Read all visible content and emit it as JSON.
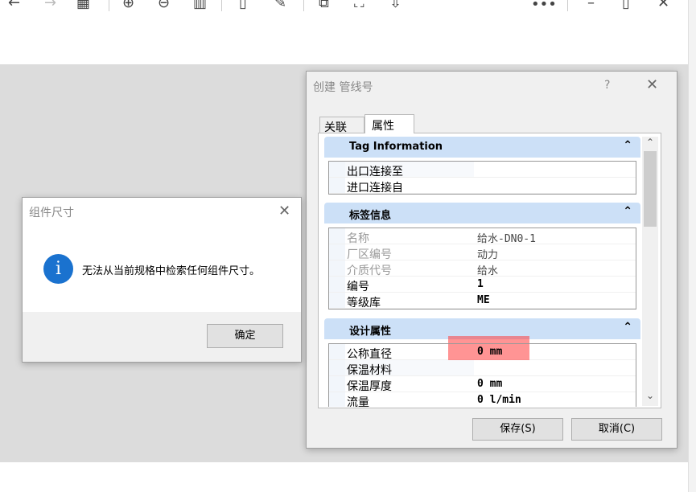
{
  "toolbar": {
    "icons": [
      "back-icon",
      "forward-icon",
      "grid-icon",
      "zoom-in-icon",
      "zoom-out-icon",
      "fit-icon",
      "page-icon",
      "edit-icon",
      "translate-icon",
      "select-icon",
      "download-icon",
      "more-icon",
      "minimize-icon",
      "maximize-icon",
      "close-icon"
    ],
    "more": "•••"
  },
  "main_dialog": {
    "title": "创建 管线号",
    "help": "?",
    "tabs": [
      {
        "label": "关联"
      },
      {
        "label": "属性"
      }
    ],
    "sections": [
      {
        "title": "Tag Information",
        "rows": [
          {
            "key": "出口连接至",
            "value": ""
          },
          {
            "key": "进口连接自",
            "value": ""
          }
        ]
      },
      {
        "title": "标签信息",
        "rows": [
          {
            "key": "名称",
            "value": "给水-DN0-1"
          },
          {
            "key": "厂区编号",
            "value": "动力"
          },
          {
            "key": "介质代号",
            "value": "给水"
          },
          {
            "key": "编号",
            "value": "1"
          },
          {
            "key": "等级库",
            "value": "ME"
          }
        ]
      },
      {
        "title": "设计属性",
        "rows": [
          {
            "key": "公称直径",
            "value": "0 mm"
          },
          {
            "key": "保温材料",
            "value": ""
          },
          {
            "key": "保温厚度",
            "value": "0 mm"
          },
          {
            "key": "流量",
            "value": "0 l/min"
          }
        ]
      }
    ],
    "save": "保存(S)",
    "cancel": "取消(C)"
  },
  "message_dialog": {
    "title": "组件尺寸",
    "message": "无法从当前规格中检索任何组件尺寸。",
    "ok": "确定",
    "info_icon": "i",
    "icon_color": "#1a72cf"
  }
}
